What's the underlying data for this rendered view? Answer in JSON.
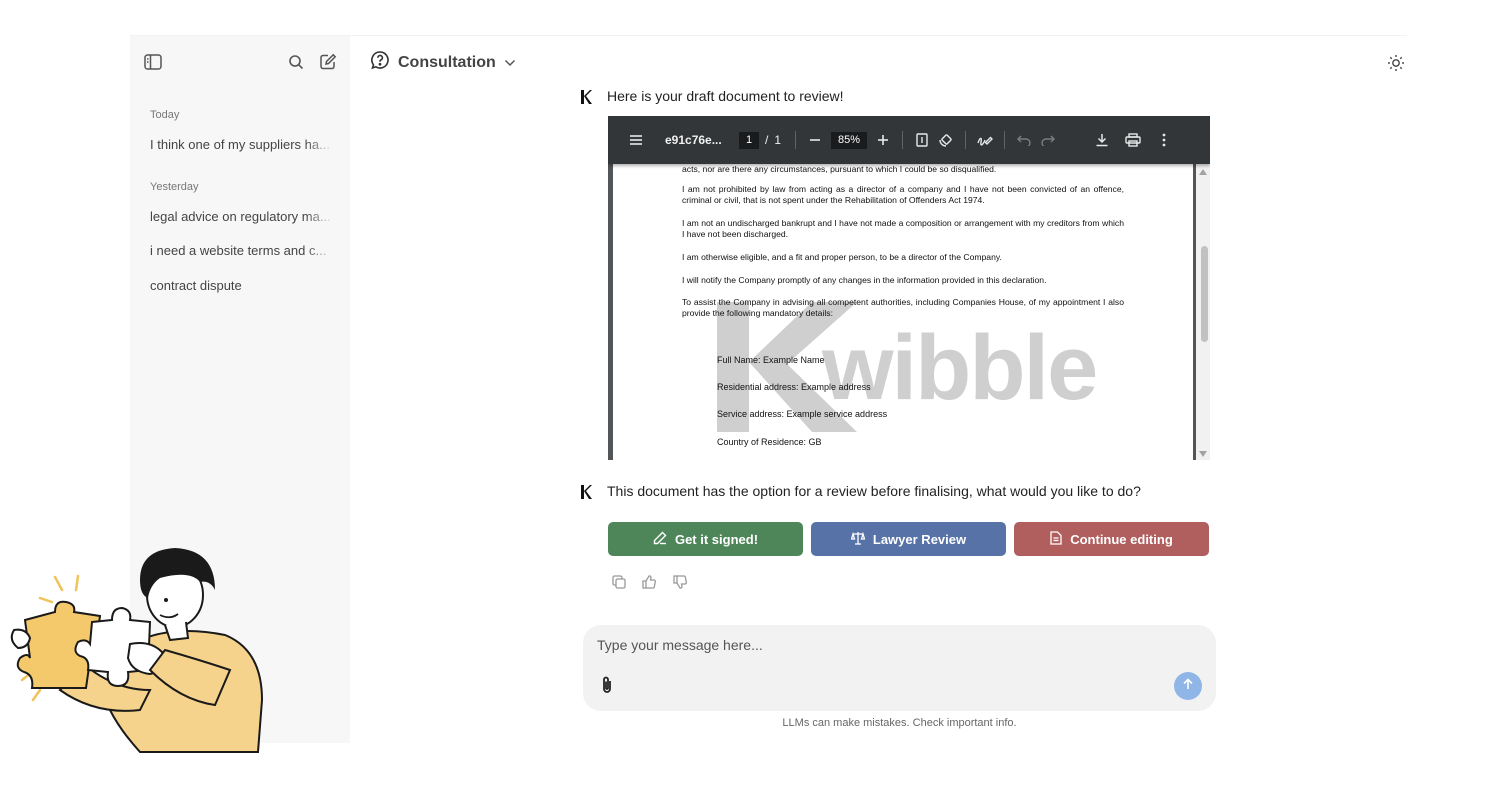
{
  "sidebar": {
    "groups": [
      {
        "label": "Today",
        "items": [
          "I think one of my suppliers ha..."
        ]
      },
      {
        "label": "Yesterday",
        "items": [
          "legal advice on regulatory ma...",
          "i need a website terms and c...",
          "contract dispute"
        ]
      }
    ],
    "icons": {
      "toggle": "sidebar-toggle-icon",
      "search": "search-icon",
      "new": "new-chat-icon"
    }
  },
  "header": {
    "title": "Consultation",
    "icon": "question-bubble-icon",
    "theme_icon": "sun-icon"
  },
  "messages": [
    {
      "text": "Here is your draft document to review!"
    },
    {
      "text": "This document has the option for a review before finalising, what would you like to do?"
    }
  ],
  "pdf": {
    "filename": "e91c76e...",
    "page_current": "1",
    "page_sep": "/",
    "page_total": "1",
    "zoom": "85%",
    "content": [
      "acts, nor are there any circumstances, pursuant to which I could be so disqualified.",
      "I am not prohibited by law from acting as a director of a company and I have not been convicted of an offence, criminal or civil, that is not spent under the Rehabilitation of Offenders Act 1974.",
      "I am not an undischarged bankrupt and I have not made a composition or arrangement with my creditors from which I have not been discharged.",
      "I am otherwise eligible, and a fit and proper person, to be a director of the Company.",
      "I will notify the Company promptly of any changes in the information provided in this declaration.",
      "To assist the Company in advising all competent authorities, including Companies House, of my appointment I also provide the following mandatory details:"
    ],
    "details": [
      "Full Name: Example Name",
      "Residential address: Example address",
      "Service address: Example service address",
      "Country of Residence: GB"
    ],
    "watermark": "wibble"
  },
  "actions": {
    "sign": "Get it signed!",
    "lawyer": "Lawyer Review",
    "edit": "Continue editing",
    "colors": {
      "sign": "#4e865a",
      "lawyer": "#5672a6",
      "edit": "#b05e5e"
    }
  },
  "composer": {
    "placeholder": "Type your message here...",
    "disclaimer": "LLMs can make mistakes. Check important info."
  }
}
